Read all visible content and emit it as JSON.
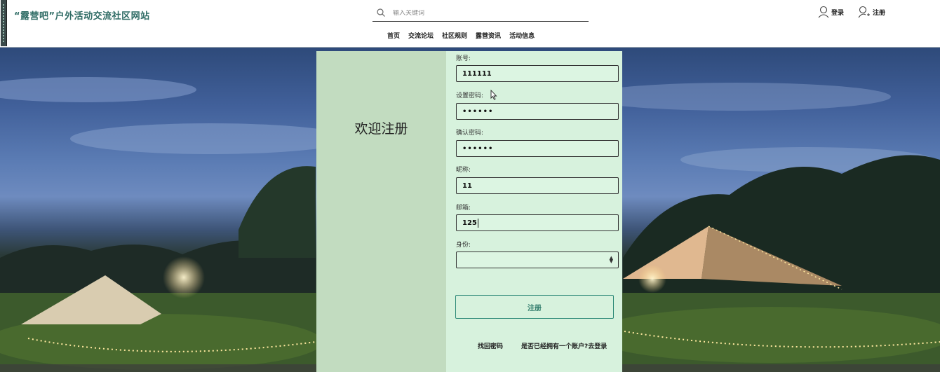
{
  "header": {
    "site_title": "“露营吧”户外活动交流社区网站",
    "search_placeholder": "输入关键词",
    "nav": [
      "首页",
      "交流论坛",
      "社区规则",
      "露营资讯",
      "活动信息"
    ],
    "login_label": "登录",
    "register_label": "注册"
  },
  "panel": {
    "welcome_text": "欢迎注册",
    "fields": {
      "account_label": "账号:",
      "account_value": "111111",
      "password_label": "设置密码:",
      "password_value": "••••••",
      "confirm_label": "确认密码:",
      "confirm_value": "••••••",
      "nickname_label": "昵称:",
      "nickname_value": "11",
      "email_label": "邮箱:",
      "email_value": "125",
      "role_label": "身份:",
      "role_value": ""
    },
    "register_button": "注册",
    "forgot_password": "找回密码",
    "have_account": "是否已经拥有一个账户?去登录"
  },
  "colors": {
    "title_color": "#2e6b64",
    "panel_left_bg": "#c2dcc0",
    "panel_right_bg": "#d7f2dd",
    "button_border": "#2e8a78"
  },
  "icons": {
    "search": "search-icon",
    "login": "user-icon",
    "register": "user-add-icon"
  }
}
